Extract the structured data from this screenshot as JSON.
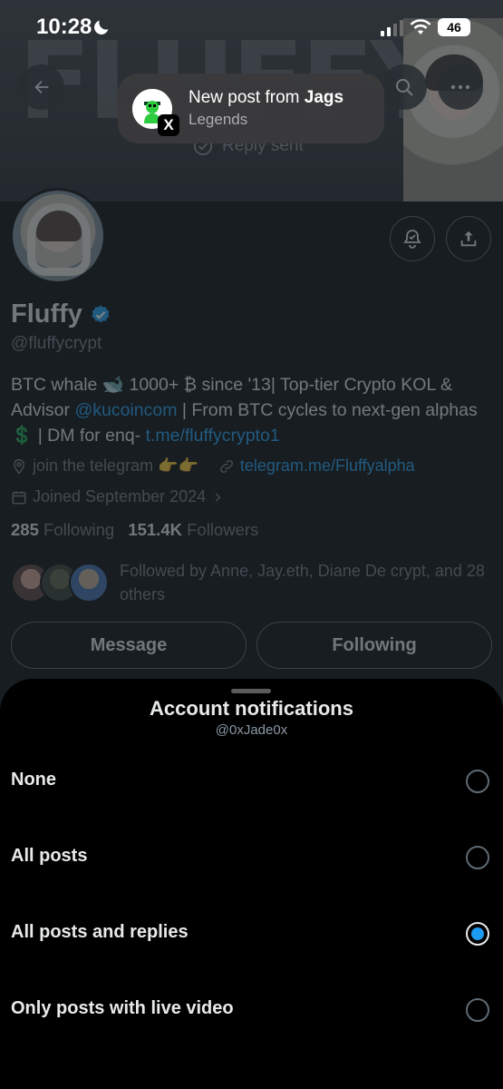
{
  "status_bar": {
    "time": "10:28",
    "battery": "46"
  },
  "notification": {
    "title_prefix": "New post from ",
    "title_name": "Jags",
    "subtitle": "Legends",
    "app_badge": "X"
  },
  "banner": {
    "text": "FLUFFYCRYPT",
    "behind_text": "Reply sent"
  },
  "profile": {
    "name": "Fluffy",
    "handle": "@fluffycrypt",
    "bio": {
      "part1": "BTC whale 🐋 1000+ ₿ since '13| Top-tier Crypto KOL & Advisor ",
      "mention": "@kucoincom",
      "part2": " | From BTC cycles to next-gen alphas 💲 | DM for enq- ",
      "url": "t.me/fluffycrypto1"
    },
    "location": "join the telegram 👉👉",
    "website": "telegram.me/Fluffyalpha",
    "joined": "Joined September 2024",
    "following_count": "285",
    "following_label": "Following",
    "followers_count": "151.4K",
    "followers_label": "Followers",
    "followed_by": "Followed by Anne, Jay.eth, Diane De crypt, and 28 others",
    "message_button": "Message",
    "following_button": "Following"
  },
  "sheet": {
    "title": "Account notifications",
    "subtitle": "@0xJade0x",
    "options": [
      {
        "label": "None",
        "selected": false
      },
      {
        "label": "All posts",
        "selected": false
      },
      {
        "label": "All posts and replies",
        "selected": true
      },
      {
        "label": "Only posts with live video",
        "selected": false
      }
    ]
  },
  "colors": {
    "accent": "#1d9bf0",
    "background": "#000000",
    "text_primary": "#e7e9ea",
    "text_secondary": "#71767b"
  }
}
